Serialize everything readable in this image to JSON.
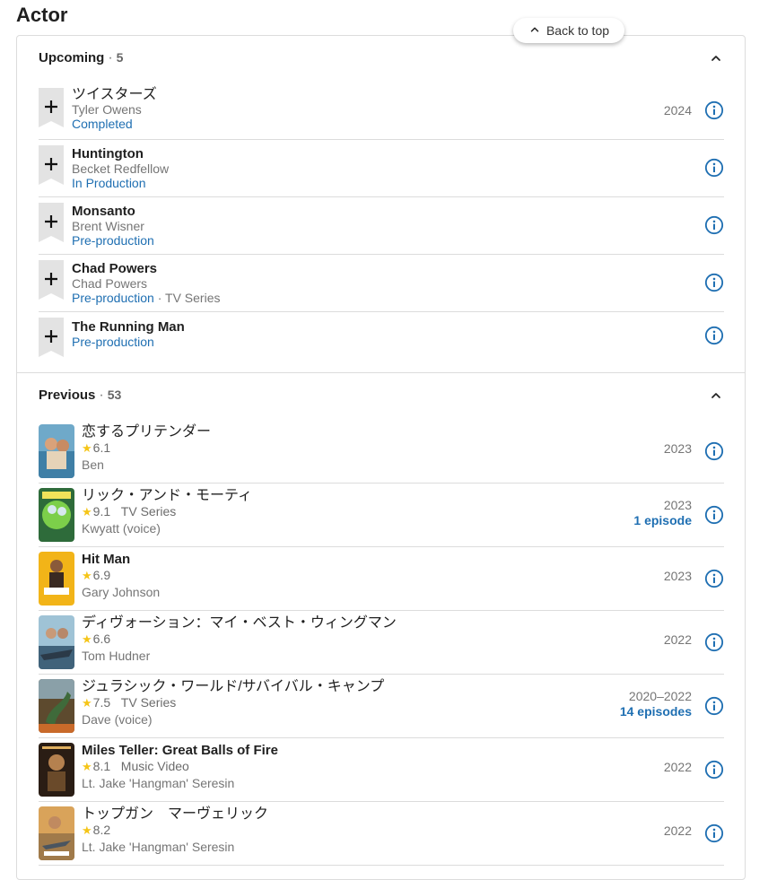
{
  "page": {
    "title": "Actor"
  },
  "back_to_top": {
    "label": "Back to top"
  },
  "upcoming": {
    "title": "Upcoming",
    "count": "5",
    "items": [
      {
        "title": "ツイスターズ",
        "role": "Tyler Owens",
        "status": "Completed",
        "type": "",
        "year": "2024"
      },
      {
        "title": "Huntington",
        "role": "Becket Redfellow",
        "status": "In Production",
        "type": "",
        "year": ""
      },
      {
        "title": "Monsanto",
        "role": "Brent Wisner",
        "status": "Pre-production",
        "type": "",
        "year": ""
      },
      {
        "title": "Chad Powers",
        "role": "Chad Powers",
        "status": "Pre-production",
        "type": "TV Series",
        "year": ""
      },
      {
        "title": "The Running Man",
        "role": "",
        "status": "Pre-production",
        "type": "",
        "year": ""
      }
    ]
  },
  "previous": {
    "title": "Previous",
    "count": "53",
    "items": [
      {
        "title": "恋するプリテンダー",
        "rating": "6.1",
        "type": "",
        "role": "Ben",
        "year": "2023",
        "episodes": ""
      },
      {
        "title": "リック・アンド・モーティ",
        "rating": "9.1",
        "type": "TV Series",
        "role": "Kwyatt (voice)",
        "year": "2023",
        "episodes": "1 episode"
      },
      {
        "title": "Hit Man",
        "rating": "6.9",
        "type": "",
        "role": "Gary Johnson",
        "year": "2023",
        "episodes": ""
      },
      {
        "title": "ディヴォーション：マイ・ベスト・ウィングマン",
        "rating": "6.6",
        "type": "",
        "role": "Tom Hudner",
        "year": "2022",
        "episodes": ""
      },
      {
        "title": "ジュラシック・ワールド/サバイバル・キャンプ",
        "rating": "7.5",
        "type": "TV Series",
        "role": "Dave (voice)",
        "year": "2020–2022",
        "episodes": "14 episodes"
      },
      {
        "title": "Miles Teller: Great Balls of Fire",
        "rating": "8.1",
        "type": "Music Video",
        "role": "Lt. Jake 'Hangman' Seresin",
        "year": "2022",
        "episodes": ""
      },
      {
        "title": "トップガン　マーヴェリック",
        "rating": "8.2",
        "type": "",
        "role": "Lt. Jake 'Hangman' Seresin",
        "year": "2022",
        "episodes": ""
      }
    ]
  },
  "colors": {
    "link": "#1f6fb2",
    "star": "#f5c518",
    "divider": "#dcdcdc"
  },
  "icons": {
    "add": "plus-bookmark-icon",
    "info": "info-circle-icon",
    "collapse": "chevron-up-icon",
    "rating": "star-icon"
  }
}
